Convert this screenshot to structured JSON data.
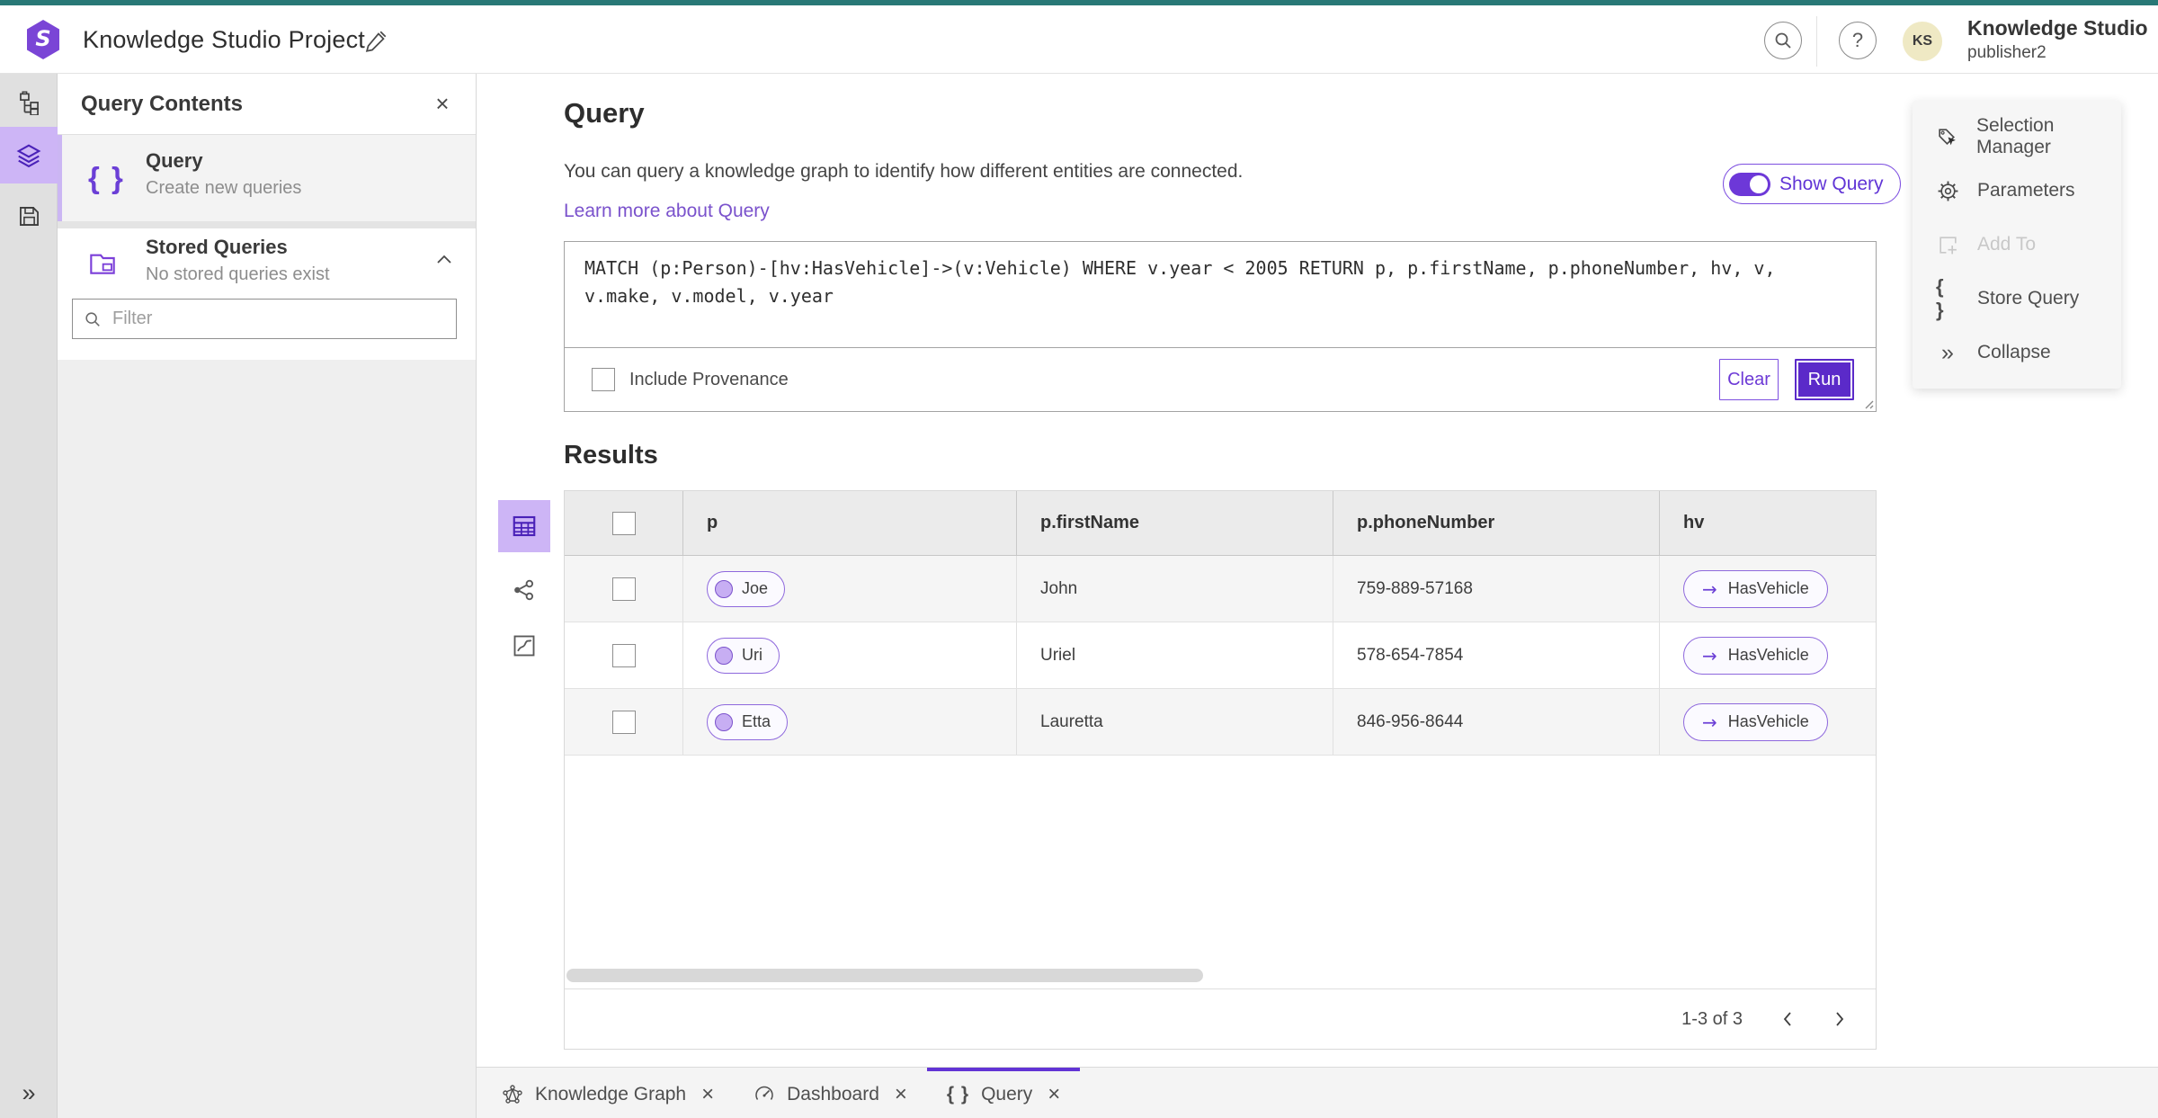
{
  "app": {
    "title": "Knowledge Studio Project"
  },
  "header": {
    "product_name": "Knowledge Studio",
    "user_name": "publisher2",
    "avatar_initials": "KS"
  },
  "icons": {
    "close": "×",
    "collapse": "»",
    "braces": "{ }",
    "arrow_right": "→",
    "question": "?"
  },
  "panel": {
    "title": "Query Contents",
    "items": [
      {
        "label": "Query",
        "sublabel": "Create new queries"
      },
      {
        "label": "Stored Queries",
        "sublabel": "No stored queries exist"
      }
    ],
    "filter_placeholder": "Filter"
  },
  "query": {
    "title": "Query",
    "description": "You can query a knowledge graph to identify how different entities are connected.",
    "link": "Learn more about Query",
    "show_query_label": "Show Query",
    "text": "MATCH (p:Person)-[hv:HasVehicle]->(v:Vehicle) WHERE v.year < 2005 RETURN p, p.firstName, p.phoneNumber, hv, v, v.make, v.model, v.year",
    "include_provenance_label": "Include Provenance",
    "clear_label": "Clear",
    "run_label": "Run"
  },
  "actions": {
    "items": [
      {
        "label": "Selection Manager"
      },
      {
        "label": "Parameters"
      },
      {
        "label": "Add To"
      },
      {
        "label": "Store Query"
      },
      {
        "label": "Collapse"
      }
    ]
  },
  "results": {
    "title": "Results",
    "table": {
      "columns": [
        "p",
        "p.firstName",
        "p.phoneNumber",
        "hv"
      ],
      "rows": [
        {
          "p": "Joe",
          "firstName": "John",
          "phoneNumber": "759-889-57168",
          "hv": "HasVehicle"
        },
        {
          "p": "Uri",
          "firstName": "Uriel",
          "phoneNumber": "578-654-7854",
          "hv": "HasVehicle"
        },
        {
          "p": "Etta",
          "firstName": "Lauretta",
          "phoneNumber": "846-956-8644",
          "hv": "HasVehicle"
        }
      ]
    },
    "pagination": {
      "range": "1-3 of 3"
    }
  },
  "tabs": [
    {
      "label": "Knowledge Graph"
    },
    {
      "label": "Dashboard"
    },
    {
      "label": "Query"
    }
  ],
  "colors": {
    "accent": "#6234d5",
    "teal": "#287876",
    "lavender": "#cdb5f6",
    "run": "#5b2ac9"
  }
}
